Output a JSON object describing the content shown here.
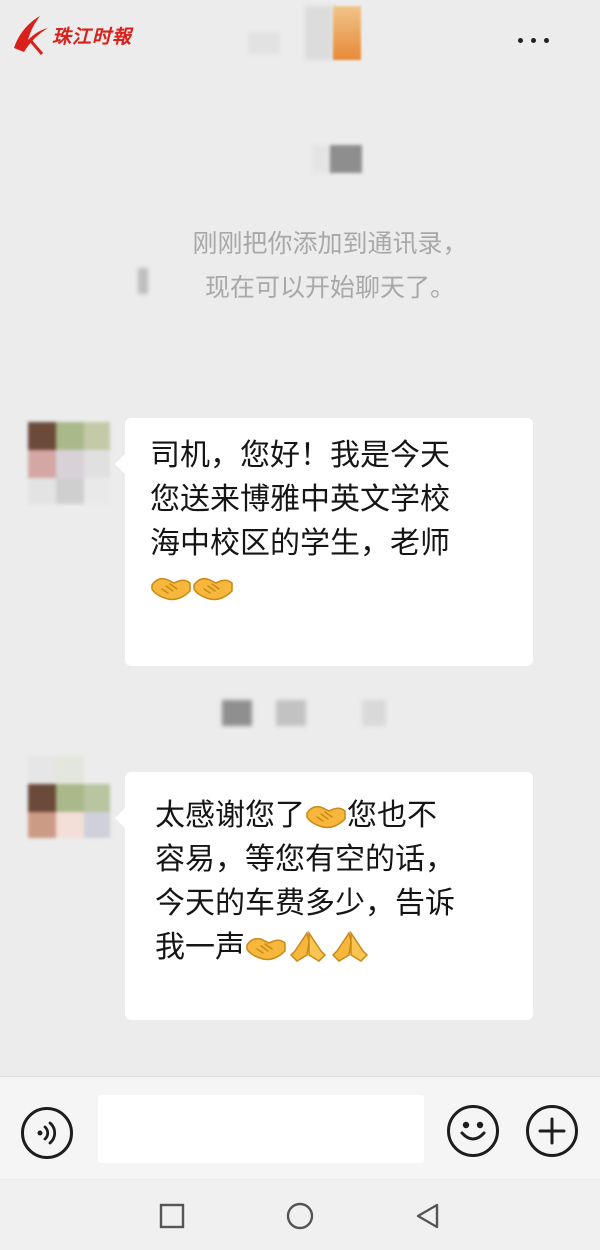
{
  "watermark": {
    "text": "珠江时報"
  },
  "system": {
    "notice_lines": [
      "刚刚把你添加到通讯录，",
      "现在可以开始聊天了。"
    ]
  },
  "messages": [
    {
      "sender": "other",
      "lines": [
        "司机，您好！我是今天",
        "您送来博雅中英文学校",
        "海中校区的学生，老师"
      ],
      "emoji_line": [
        "handshake",
        "handshake"
      ]
    },
    {
      "sender": "other",
      "line_1_before": "太感谢您了",
      "line_1_emoji": "handshake",
      "line_1_after": "您也不",
      "lines": [
        "容易，等您有空的话，",
        "今天的车费多少，告诉"
      ],
      "last_line_text": "我一声",
      "last_line_emojis": [
        "handshake",
        "folded-hands",
        "folded-hands"
      ]
    }
  ],
  "input": {
    "value": "",
    "placeholder": ""
  },
  "icons": {
    "more": "more-dots-icon",
    "voice": "voice-icon",
    "emoji": "smiley-icon",
    "plus": "plus-icon",
    "nav": [
      "square-icon",
      "circle-icon",
      "triangle-back-icon"
    ]
  },
  "colors": {
    "background": "#ececec",
    "bubble": "#ffffff",
    "watermark": "#d9201a",
    "system_text": "#a8a8a8"
  }
}
